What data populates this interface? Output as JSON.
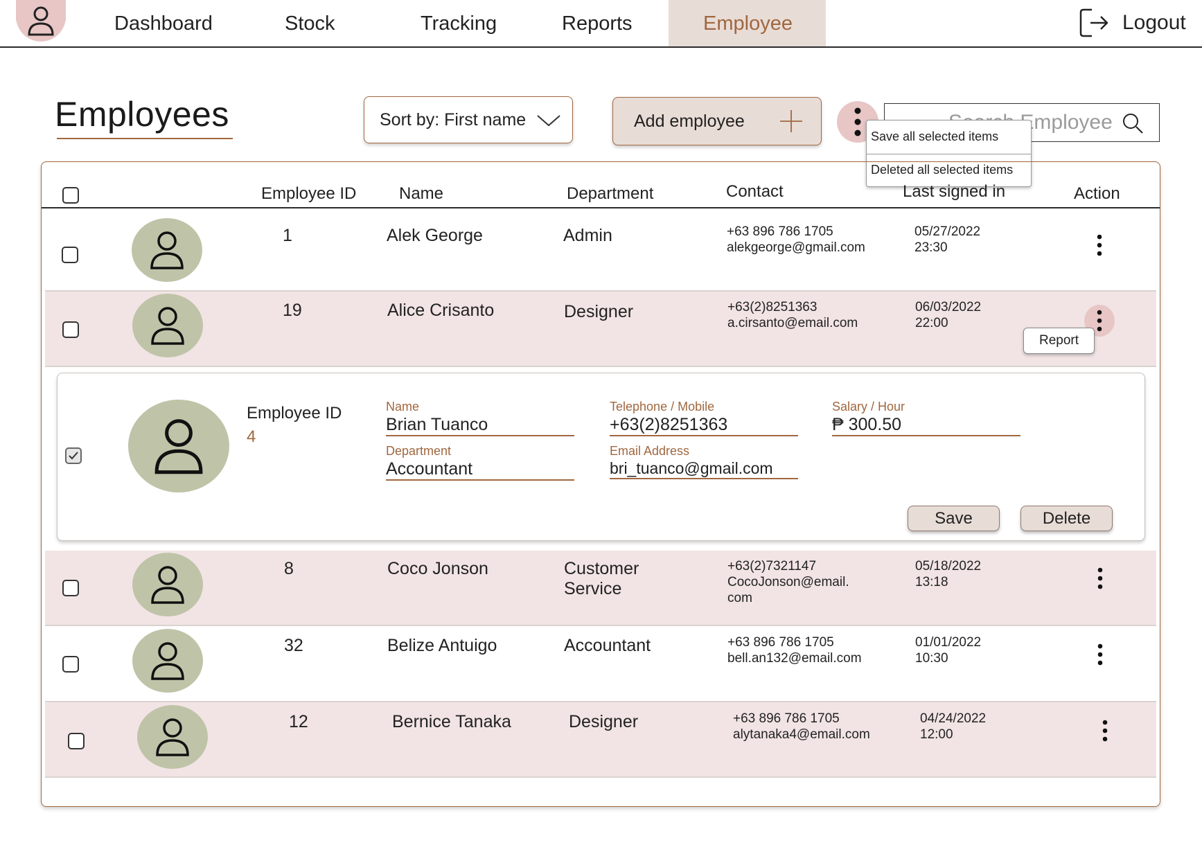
{
  "nav": {
    "items": [
      "Dashboard",
      "Stock",
      "Tracking",
      "Reports",
      "Employee"
    ],
    "active": "Employee",
    "logout": "Logout"
  },
  "page": {
    "title": "Employees"
  },
  "controls": {
    "sort_label": "Sort by: First name",
    "add_label": "Add employee",
    "search_placeholder": "Search Employee"
  },
  "bulk_menu": [
    "Save all selected items",
    "Deleted all selected items"
  ],
  "table": {
    "columns": [
      "Employee ID",
      "Name",
      "Department",
      "Contact",
      "Last signed in",
      "Action"
    ],
    "rows": [
      {
        "id": "1",
        "name": "Alek George",
        "dept": "Admin",
        "dept2": "",
        "phone": "+63 896 786 1705",
        "email": "alekgeorge@gmail.com",
        "email2": "",
        "date": "05/27/2022",
        "time": "23:30"
      },
      {
        "id": "19",
        "name": "Alice Crisanto",
        "dept": "Designer",
        "dept2": "",
        "phone": "+63(2)8251363",
        "email": "a.cirsanto@email.com",
        "email2": "",
        "date": "06/03/2022",
        "time": "22:00"
      },
      {
        "id": "8",
        "name": "Coco Jonson",
        "dept": "Customer",
        "dept2": "Service",
        "phone": "+63(2)7321147",
        "email": "CocoJonson@email.",
        "email2": "com",
        "date": "05/18/2022",
        "time": "13:18"
      },
      {
        "id": "32",
        "name": "Belize Antuigo",
        "dept": "Accountant",
        "dept2": "",
        "phone": "+63 896 786 1705",
        "email": "bell.an132@email.com",
        "email2": "",
        "date": "01/01/2022",
        "time": "10:30"
      },
      {
        "id": "12",
        "name": "Bernice Tanaka",
        "dept": "Designer",
        "dept2": "",
        "phone": "+63 896 786 1705",
        "email": "alytanaka4@email.com",
        "email2": "",
        "date": "04/24/2022",
        "time": "12:00"
      }
    ],
    "row_menu": "Report"
  },
  "editor": {
    "id_label": "Employee ID",
    "id_value": "4",
    "name_label": "Name",
    "name_value": "Brian Tuanco",
    "phone_label": "Telephone / Mobile",
    "phone_value": "+63(2)8251363",
    "salary_label": "Salary / Hour",
    "salary_value": "₱ 300.50",
    "dept_label": "Department",
    "dept_value": "Accountant",
    "email_label": "Email Address",
    "email_value": "bri_tuanco@gmail.com",
    "save": "Save",
    "delete": "Delete"
  },
  "colors": {
    "accent": "#a0673f",
    "pink": "#f2e4e4",
    "nav_active_bg": "#e8dcd6",
    "avatar": "#bfc4a8",
    "kebab_bg": "#e8c6c6"
  }
}
